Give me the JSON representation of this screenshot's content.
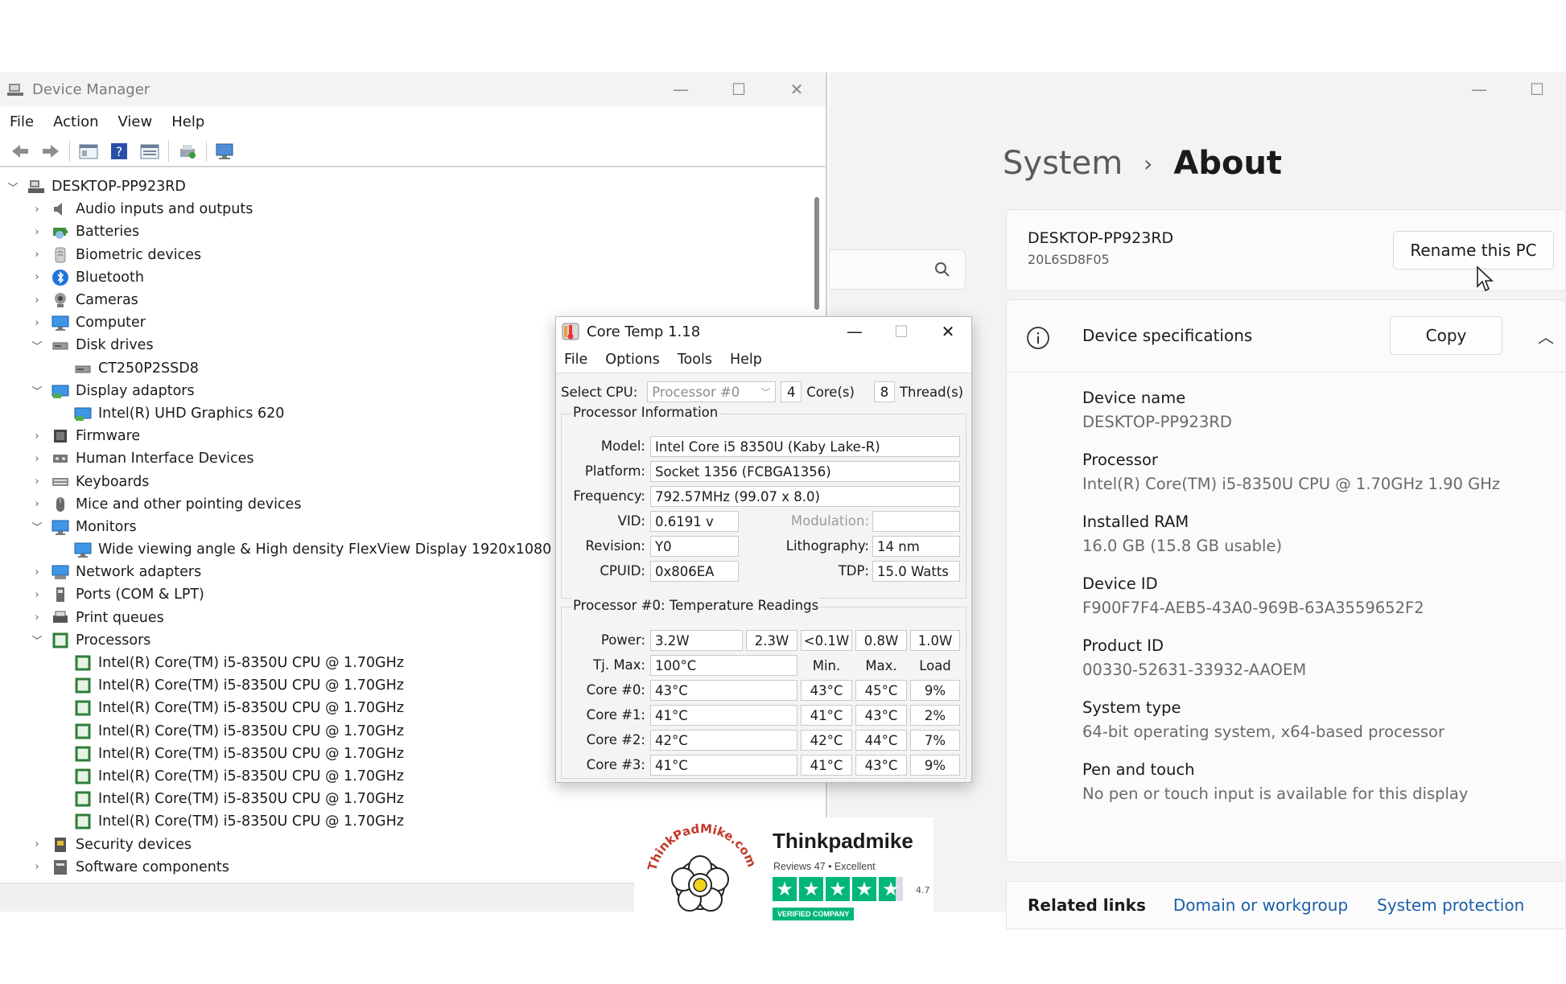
{
  "device_manager": {
    "title": "Device Manager",
    "menu": [
      "File",
      "Action",
      "View",
      "Help"
    ],
    "root": "DESKTOP-PP923RD",
    "tree": [
      {
        "label": "Audio inputs and outputs",
        "level": 1,
        "expanded": false,
        "icon": "speaker-icon"
      },
      {
        "label": "Batteries",
        "level": 1,
        "expanded": false,
        "icon": "battery-icon"
      },
      {
        "label": "Biometric devices",
        "level": 1,
        "expanded": false,
        "icon": "fingerprint-icon"
      },
      {
        "label": "Bluetooth",
        "level": 1,
        "expanded": false,
        "icon": "bluetooth-icon"
      },
      {
        "label": "Cameras",
        "level": 1,
        "expanded": false,
        "icon": "camera-icon"
      },
      {
        "label": "Computer",
        "level": 1,
        "expanded": false,
        "icon": "monitor-icon"
      },
      {
        "label": "Disk drives",
        "level": 1,
        "expanded": true,
        "icon": "disk-icon"
      },
      {
        "label": "CT250P2SSD8",
        "level": 2,
        "icon": "disk-icon"
      },
      {
        "label": "Display adaptors",
        "level": 1,
        "expanded": true,
        "icon": "display-adapter-icon"
      },
      {
        "label": "Intel(R) UHD Graphics 620",
        "level": 2,
        "icon": "display-adapter-icon"
      },
      {
        "label": "Firmware",
        "level": 1,
        "expanded": false,
        "icon": "firmware-icon"
      },
      {
        "label": "Human Interface Devices",
        "level": 1,
        "expanded": false,
        "icon": "hid-icon"
      },
      {
        "label": "Keyboards",
        "level": 1,
        "expanded": false,
        "icon": "keyboard-icon"
      },
      {
        "label": "Mice and other pointing devices",
        "level": 1,
        "expanded": false,
        "icon": "mouse-icon"
      },
      {
        "label": "Monitors",
        "level": 1,
        "expanded": true,
        "icon": "monitor-icon"
      },
      {
        "label": "Wide viewing angle & High density FlexView Display 1920x1080",
        "level": 2,
        "icon": "monitor-icon"
      },
      {
        "label": "Network adapters",
        "level": 1,
        "expanded": false,
        "icon": "network-icon"
      },
      {
        "label": "Ports (COM & LPT)",
        "level": 1,
        "expanded": false,
        "icon": "port-icon"
      },
      {
        "label": "Print queues",
        "level": 1,
        "expanded": false,
        "icon": "printer-icon"
      },
      {
        "label": "Processors",
        "level": 1,
        "expanded": true,
        "icon": "cpu-icon"
      },
      {
        "label": "Intel(R) Core(TM) i5-8350U CPU @ 1.70GHz",
        "level": 2,
        "icon": "cpu-icon"
      },
      {
        "label": "Intel(R) Core(TM) i5-8350U CPU @ 1.70GHz",
        "level": 2,
        "icon": "cpu-icon"
      },
      {
        "label": "Intel(R) Core(TM) i5-8350U CPU @ 1.70GHz",
        "level": 2,
        "icon": "cpu-icon"
      },
      {
        "label": "Intel(R) Core(TM) i5-8350U CPU @ 1.70GHz",
        "level": 2,
        "icon": "cpu-icon"
      },
      {
        "label": "Intel(R) Core(TM) i5-8350U CPU @ 1.70GHz",
        "level": 2,
        "icon": "cpu-icon"
      },
      {
        "label": "Intel(R) Core(TM) i5-8350U CPU @ 1.70GHz",
        "level": 2,
        "icon": "cpu-icon"
      },
      {
        "label": "Intel(R) Core(TM) i5-8350U CPU @ 1.70GHz",
        "level": 2,
        "icon": "cpu-icon"
      },
      {
        "label": "Intel(R) Core(TM) i5-8350U CPU @ 1.70GHz",
        "level": 2,
        "icon": "cpu-icon"
      },
      {
        "label": "Security devices",
        "level": 1,
        "expanded": false,
        "icon": "security-icon"
      },
      {
        "label": "Software components",
        "level": 1,
        "expanded": false,
        "icon": "software-icon"
      }
    ]
  },
  "settings": {
    "breadcrumb_parent": "System",
    "breadcrumb_current": "About",
    "pc_name": "DESKTOP-PP923RD",
    "pc_model": "20L6SD8F05",
    "rename_label": "Rename this PC",
    "specs_title": "Device specifications",
    "copy_label": "Copy",
    "specs": [
      {
        "label": "Device name",
        "value": "DESKTOP-PP923RD"
      },
      {
        "label": "Processor",
        "value": "Intel(R) Core(TM) i5-8350U CPU @ 1.70GHz   1.90 GHz"
      },
      {
        "label": "Installed RAM",
        "value": "16.0 GB (15.8 GB usable)"
      },
      {
        "label": "Device ID",
        "value": "F900F7F4-AEB5-43A0-969B-63A3559652F2"
      },
      {
        "label": "Product ID",
        "value": "00330-52631-33932-AAOEM"
      },
      {
        "label": "System type",
        "value": "64-bit operating system, x64-based processor"
      },
      {
        "label": "Pen and touch",
        "value": "No pen or touch input is available for this display"
      }
    ],
    "related_label": "Related links",
    "related_links": [
      "Domain or workgroup",
      "System protection"
    ]
  },
  "coretemp": {
    "title": "Core Temp 1.18",
    "menu": [
      "File",
      "Options",
      "Tools",
      "Help"
    ],
    "select_cpu_label": "Select CPU:",
    "select_cpu_value": "Processor #0",
    "cores": "4",
    "cores_label": "Core(s)",
    "threads": "8",
    "threads_label": "Thread(s)",
    "proc_info_title": "Processor Information",
    "model_label": "Model:",
    "model": "Intel Core i5 8350U (Kaby Lake-R)",
    "platform_label": "Platform:",
    "platform": "Socket 1356 (FCBGA1356)",
    "frequency_label": "Frequency:",
    "frequency": "792.57MHz (99.07 x 8.0)",
    "vid_label": "VID:",
    "vid": "0.6191 v",
    "modulation_label": "Modulation:",
    "modulation": "",
    "revision_label": "Revision:",
    "revision": "Y0",
    "lithography_label": "Lithography:",
    "lithography": "14 nm",
    "cpuid_label": "CPUID:",
    "cpuid": "0x806EA",
    "tdp_label": "TDP:",
    "tdp": "15.0 Watts",
    "temp_title": "Processor #0: Temperature Readings",
    "power_label": "Power:",
    "power": [
      "3.2W",
      "2.3W",
      "<0.1W",
      "0.8W",
      "1.0W"
    ],
    "tjmax_label": "Tj. Max:",
    "tjmax": "100°C",
    "col_min": "Min.",
    "col_max": "Max.",
    "col_load": "Load",
    "cores_data": [
      {
        "label": "Core #0:",
        "temp": "43°C",
        "min": "43°C",
        "max": "45°C",
        "load": "9%"
      },
      {
        "label": "Core #1:",
        "temp": "41°C",
        "min": "41°C",
        "max": "43°C",
        "load": "2%"
      },
      {
        "label": "Core #2:",
        "temp": "42°C",
        "min": "42°C",
        "max": "44°C",
        "load": "7%"
      },
      {
        "label": "Core #3:",
        "temp": "41°C",
        "min": "41°C",
        "max": "43°C",
        "load": "9%"
      }
    ]
  },
  "badge": {
    "brand": "Thinkpadmike",
    "reviews": "Reviews 47  •  Excellent",
    "rating": "4.7",
    "verified": "VERIFIED COMPANY",
    "logo_text": "ThinkPadMike.com"
  }
}
